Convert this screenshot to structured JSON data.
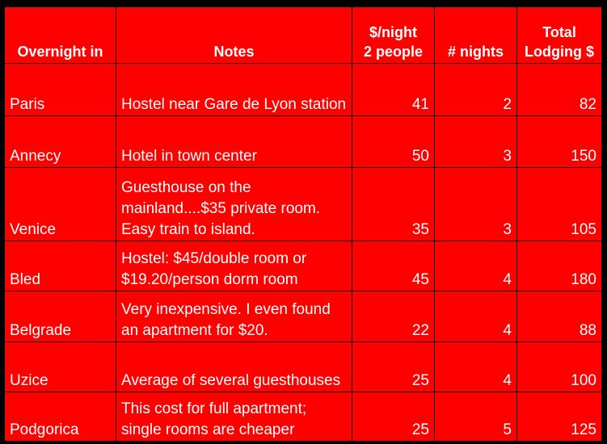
{
  "table": {
    "columns": [
      {
        "key": "place",
        "label": "Overnight in",
        "label_lines": [
          "Overnight in"
        ]
      },
      {
        "key": "notes",
        "label": "Notes",
        "label_lines": [
          "Notes"
        ]
      },
      {
        "key": "rate",
        "label": "$/night 2 people",
        "label_lines": [
          "$/night",
          "2 people"
        ]
      },
      {
        "key": "nights",
        "label": "# nights",
        "label_lines": [
          "# nights"
        ]
      },
      {
        "key": "total",
        "label": "Total Lodging $",
        "label_lines": [
          "Total",
          "Lodging $"
        ]
      }
    ],
    "rows": [
      {
        "place": "Paris",
        "notes": "Hostel near Gare de Lyon station",
        "rate": "41",
        "nights": "2",
        "total": "82"
      },
      {
        "place": "Annecy",
        "notes": "Hotel in town center",
        "rate": "50",
        "nights": "3",
        "total": "150"
      },
      {
        "place": "Venice",
        "notes": "Guesthouse on the mainland....$35 private room. Easy train to island.",
        "rate": "35",
        "nights": "3",
        "total": "105"
      },
      {
        "place": "Bled",
        "notes": "Hostel: $45/double room or $19.20/person dorm room",
        "rate": "45",
        "nights": "4",
        "total": "180"
      },
      {
        "place": "Belgrade",
        "notes": "Very inexpensive. I even found an apartment for $20.",
        "rate": "22",
        "nights": "4",
        "total": "88"
      },
      {
        "place": "Uzice",
        "notes": "Average of several guesthouses",
        "rate": "25",
        "nights": "4",
        "total": "100"
      },
      {
        "place": "Podgorica",
        "notes": "This cost for full apartment; single rooms are cheaper",
        "rate": "25",
        "nights": "5",
        "total": "125"
      }
    ]
  },
  "colors": {
    "cell_background": "#FF0000",
    "text": "#FFFFFF",
    "grid_line": "#000000",
    "page_background": "#000000"
  }
}
